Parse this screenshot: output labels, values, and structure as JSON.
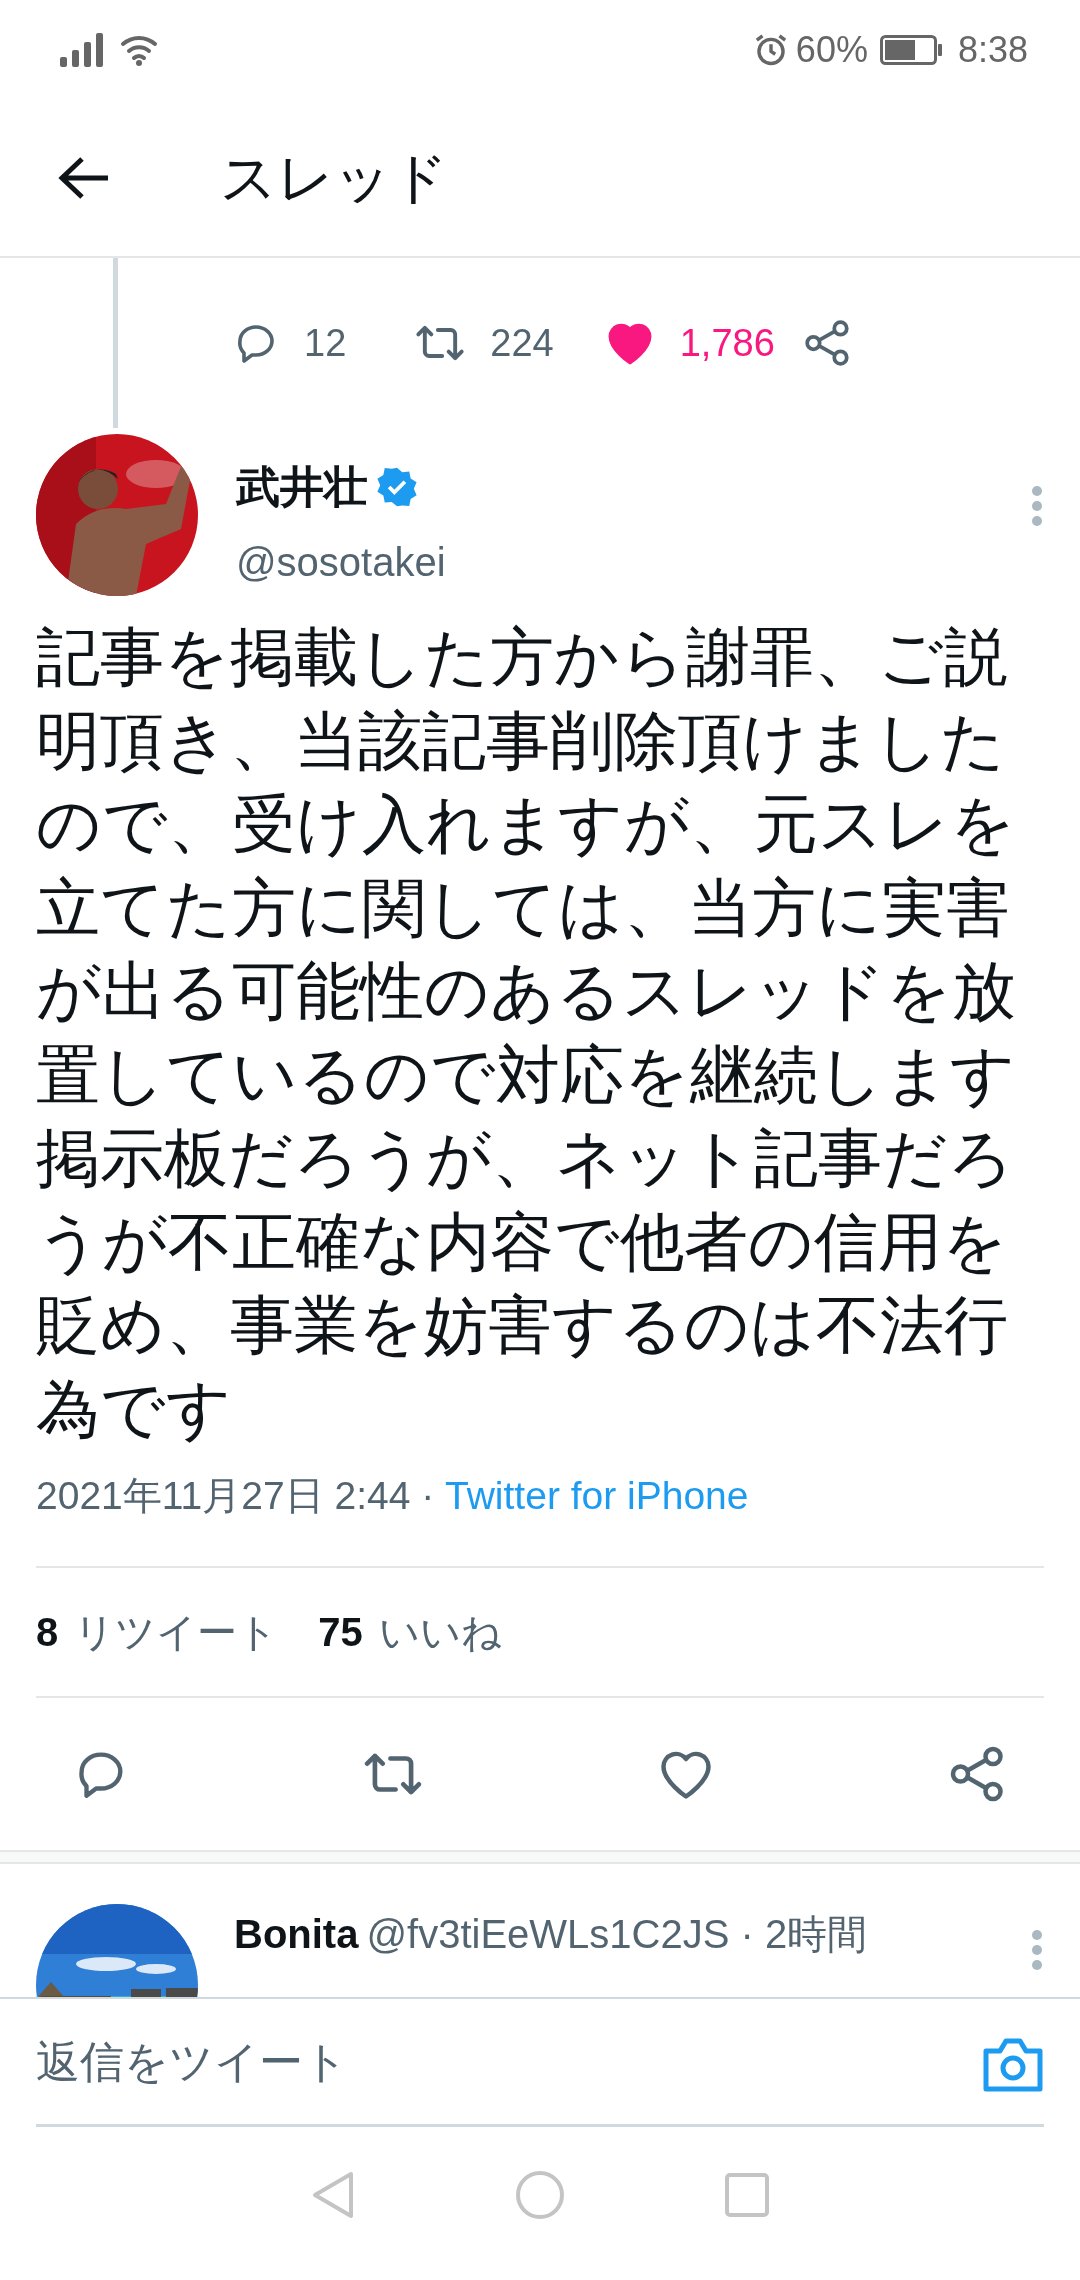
{
  "status_bar": {
    "battery": "60%",
    "time": "8:38"
  },
  "header": {
    "title": "スレッド"
  },
  "previous_tweet": {
    "replies": "12",
    "retweets": "224",
    "likes": "1,786",
    "liked": true
  },
  "tweet": {
    "name": "武井壮",
    "verified": true,
    "handle": "@sosotakei",
    "paragraphs": [
      "記事を掲載した方から謝罪、ご説明頂き、当該記事削除頂けましたので、受け入れますが、元スレを立てた方に関しては、当方に実害が出る可能性のあるスレッドを放置しているので対応を継続します",
      "掲示板だろうが、ネット記事だろうが不正確な内容で他者の信用を貶め、事業を妨害するのは不法行為です"
    ],
    "timestamp": "2021年11月27日 2:44",
    "separator": "·",
    "source": "Twitter for iPhone",
    "retweet_count": "8",
    "retweet_label": "リツイート",
    "like_count": "75",
    "like_label": "いいね",
    "liked": false
  },
  "replies": [
    {
      "name": "Bonita",
      "handle": "@fv3tiEeWLs1C2JS",
      "separator": "·",
      "time": "2時間"
    }
  ],
  "composer": {
    "placeholder": "返信をツイート"
  }
}
